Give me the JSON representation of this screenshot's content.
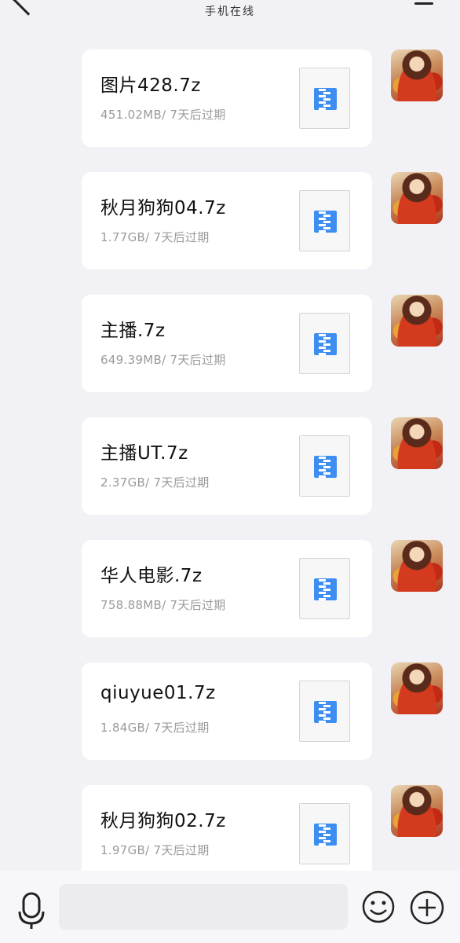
{
  "header": {
    "status": "手机在线"
  },
  "messages": [
    {
      "file_name": "图片428.7z",
      "file_meta": "451.02MB/ 7天后过期"
    },
    {
      "file_name": "秋月狗狗04.7z",
      "file_meta": "1.77GB/ 7天后过期"
    },
    {
      "file_name": "主播.7z",
      "file_meta": "649.39MB/ 7天后过期"
    },
    {
      "file_name": "主播UT.7z",
      "file_meta": "2.37GB/ 7天后过期"
    },
    {
      "file_name": "华人电影.7z",
      "file_meta": "758.88MB/ 7天后过期"
    },
    {
      "file_name": "qiuyue01.7z",
      "file_meta": "1.84GB/ 7天后过期"
    },
    {
      "file_name": "秋月狗狗02.7z",
      "file_meta": "1.97GB/ 7天后过期"
    }
  ],
  "input": {
    "value": "",
    "placeholder": ""
  },
  "icons": {
    "back": "back-arrow-icon",
    "menu": "menu-icon",
    "file": "zip-file-icon",
    "voice": "microphone-icon",
    "emoji": "smiley-icon",
    "more": "plus-circle-icon"
  },
  "colors": {
    "background": "#f2f2f6",
    "bubble": "#ffffff",
    "zip_icon": "#3d8ef0",
    "meta_text": "#9a9a9a"
  }
}
